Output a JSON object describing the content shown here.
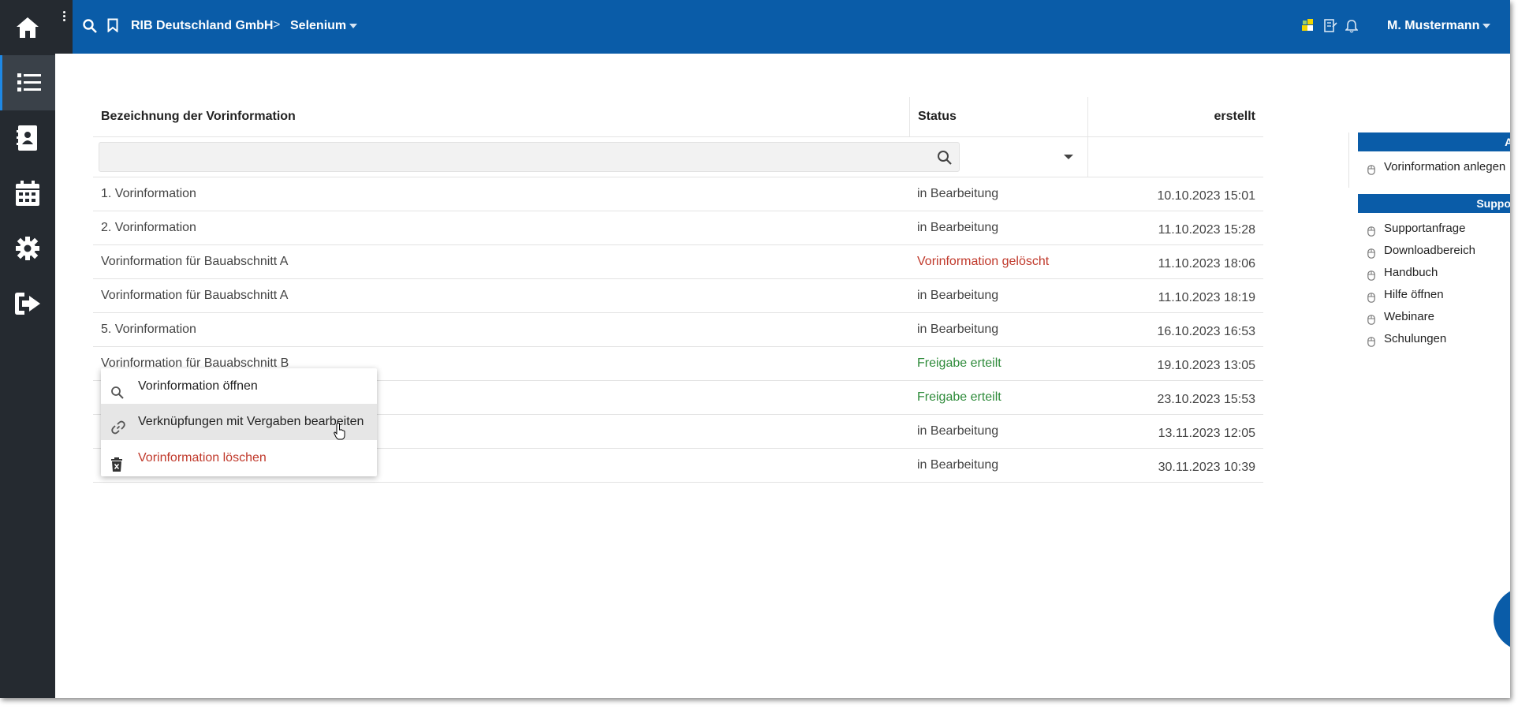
{
  "topbar": {
    "company": "RIB Deutschland GmbH",
    "separator": ">",
    "project": "Selenium",
    "user": "M. Mustermann"
  },
  "table": {
    "headers": {
      "name": "Bezeichnung der Vorinformation",
      "status": "Status",
      "created": "erstellt"
    },
    "rows": [
      {
        "name": "1. Vorinformation",
        "status": "in Bearbeitung",
        "status_type": "normal",
        "created": "10.10.2023 15:01"
      },
      {
        "name": "2. Vorinformation",
        "status": "in Bearbeitung",
        "status_type": "normal",
        "created": "11.10.2023 15:28"
      },
      {
        "name": "Vorinformation für Bauabschnitt A",
        "status": "Vorinformation gelöscht",
        "status_type": "deleted",
        "created": "11.10.2023 18:06"
      },
      {
        "name": "Vorinformation für Bauabschnitt A",
        "status": "in Bearbeitung",
        "status_type": "normal",
        "created": "11.10.2023 18:19"
      },
      {
        "name": "5. Vorinformation",
        "status": "in Bearbeitung",
        "status_type": "normal",
        "created": "16.10.2023 16:53"
      },
      {
        "name": "Vorinformation für Bauabschnitt B",
        "status": "Freigabe erteilt",
        "status_type": "approved",
        "created": "19.10.2023 13:05"
      },
      {
        "name": "",
        "status": "Freigabe erteilt",
        "status_type": "approved",
        "created": "23.10.2023 15:53"
      },
      {
        "name": "",
        "status": "in Bearbeitung",
        "status_type": "normal",
        "created": "13.11.2023 12:05"
      },
      {
        "name": "",
        "status": "in Bearbeitung",
        "status_type": "normal",
        "created": "30.11.2023 10:39"
      }
    ]
  },
  "context_menu": {
    "open": "Vorinformation öffnen",
    "edit_links": "Verknüpfungen mit Vergaben bearbeiten",
    "delete": "Vorinformation löschen"
  },
  "side_panel": {
    "actions_title": "Aktionen",
    "actions": [
      "Vorinformation anlegen"
    ],
    "support_title": "Support / Hilfe",
    "support": [
      "Supportanfrage",
      "Downloadbereich",
      "Handbuch",
      "Hilfe öffnen",
      "Webinare",
      "Schulungen"
    ]
  },
  "colors": {
    "brand_blue": "#0a5ca8",
    "sidebar": "#252a30",
    "deleted_red": "#c0392b",
    "approved_green": "#2e8b3a"
  }
}
